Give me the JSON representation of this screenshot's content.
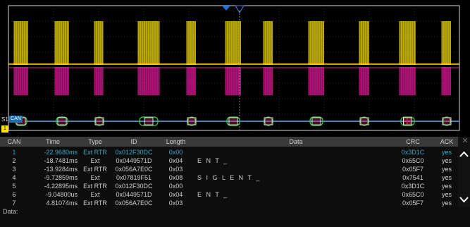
{
  "scope": {
    "serial_channel": "S1",
    "protocol_tag": "CAN",
    "channel_marker": "1",
    "colors": {
      "ch1": "#ffe600",
      "ch2": "#e0189a",
      "bus": "#5ab4e0",
      "grid": "#2a2a2a",
      "frame": "#e8e8e8"
    }
  },
  "table": {
    "headers": {
      "can": "CAN",
      "time": "Time",
      "type": "Type",
      "id": "ID",
      "length": "Length",
      "data": "Data",
      "crc": "CRC",
      "ack": "ACK"
    },
    "rows": [
      {
        "can": "1",
        "time": "-22.9680ms",
        "type": "Ext RTR",
        "id": "0x012F30DC",
        "length": "0x00",
        "data": "",
        "crc": "0x3D1C",
        "ack": "yes"
      },
      {
        "can": "2",
        "time": "-18.7481ms",
        "type": "Ext",
        "id": "0x0449571D",
        "length": "0x04",
        "data": "E N T _",
        "crc": "0x65C0",
        "ack": "yes"
      },
      {
        "can": "3",
        "time": "-13.9284ms",
        "type": "Ext RTR",
        "id": "0x056A7E0C",
        "length": "0x03",
        "data": "",
        "crc": "0x05F7",
        "ack": "yes"
      },
      {
        "can": "4",
        "time": "-9.72859ms",
        "type": "Ext",
        "id": "0x07819F51",
        "length": "0x08",
        "data": "S I G L E N T _",
        "crc": "0x7541",
        "ack": "yes"
      },
      {
        "can": "5",
        "time": "-4.22895ms",
        "type": "Ext RTR",
        "id": "0x012F30DC",
        "length": "0x00",
        "data": "",
        "crc": "0x3D1C",
        "ack": "yes"
      },
      {
        "can": "6",
        "time": "-9.04800us",
        "type": "Ext",
        "id": "0x0449571D",
        "length": "0x04",
        "data": "E N T _",
        "crc": "0x65C0",
        "ack": "yes"
      },
      {
        "can": "7",
        "time": "4.81074ms",
        "type": "Ext RTR",
        "id": "0x056A7E0C",
        "length": "0x03",
        "data": "",
        "crc": "0x05F7",
        "ack": "yes"
      }
    ],
    "data_label": "Data:",
    "close_icon": "close-icon",
    "scroll_up_icon": "chevron-up-icon",
    "scroll_down_icon": "chevron-down-icon"
  }
}
